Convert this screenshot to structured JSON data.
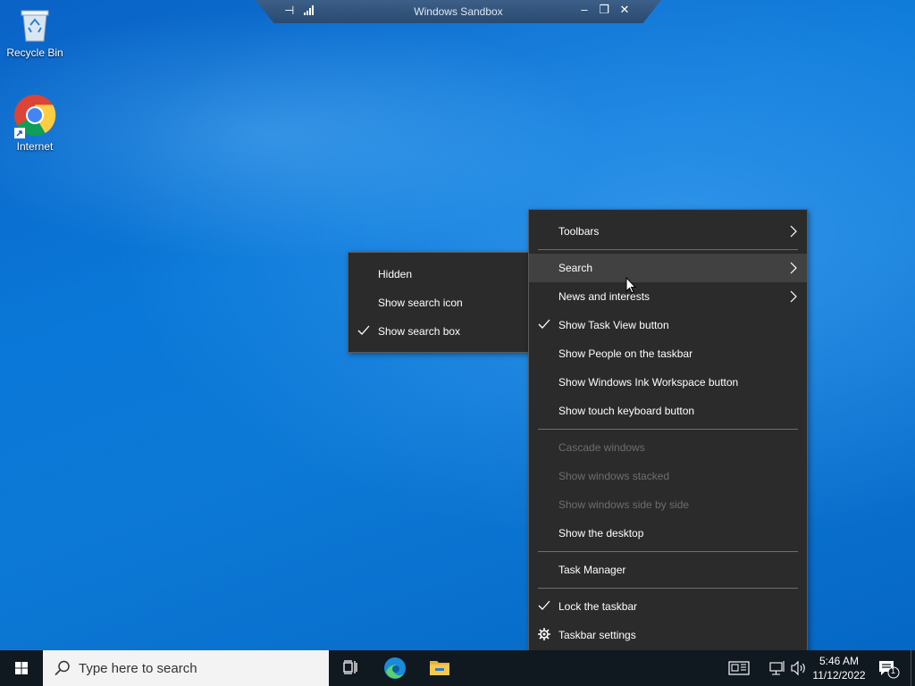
{
  "sandbox": {
    "title": "Windows Sandbox",
    "min_glyph": "–",
    "restore_glyph": "❐",
    "close_glyph": "✕",
    "pin_glyph": "⊣"
  },
  "desktop": {
    "icons": [
      {
        "label": "Recycle Bin",
        "icon": "recycle-bin-icon"
      },
      {
        "label": "Internet",
        "icon": "chrome-icon"
      }
    ]
  },
  "context_menu": {
    "items": [
      {
        "label": "Toolbars",
        "submenu": true
      },
      {
        "label": "Search",
        "submenu": true,
        "hover": true
      },
      {
        "label": "News and interests",
        "submenu": true
      },
      {
        "label": "Show Task View button",
        "checked": true
      },
      {
        "label": "Show People on the taskbar"
      },
      {
        "label": "Show Windows Ink Workspace button"
      },
      {
        "label": "Show touch keyboard button"
      },
      {
        "label": "Cascade windows",
        "disabled": true
      },
      {
        "label": "Show windows stacked",
        "disabled": true
      },
      {
        "label": "Show windows side by side",
        "disabled": true
      },
      {
        "label": "Show the desktop"
      },
      {
        "label": "Task Manager"
      },
      {
        "label": "Lock the taskbar",
        "checked": true
      },
      {
        "label": "Taskbar settings",
        "icon": "gear-icon"
      }
    ]
  },
  "search_submenu": {
    "items": [
      {
        "label": "Hidden"
      },
      {
        "label": "Show search icon"
      },
      {
        "label": "Show search box",
        "checked": true
      }
    ]
  },
  "taskbar": {
    "search_placeholder": "Type here to search",
    "time": "5:46 AM",
    "date": "11/12/2022",
    "notification_count": "1",
    "apps": [
      "task-view-icon",
      "edge-icon",
      "file-explorer-icon"
    ]
  },
  "colors": {
    "menu_bg": "#2b2b2b",
    "menu_hover": "#414141",
    "taskbar_bg": "#101820",
    "desktop_blue": "#0a78d8"
  }
}
